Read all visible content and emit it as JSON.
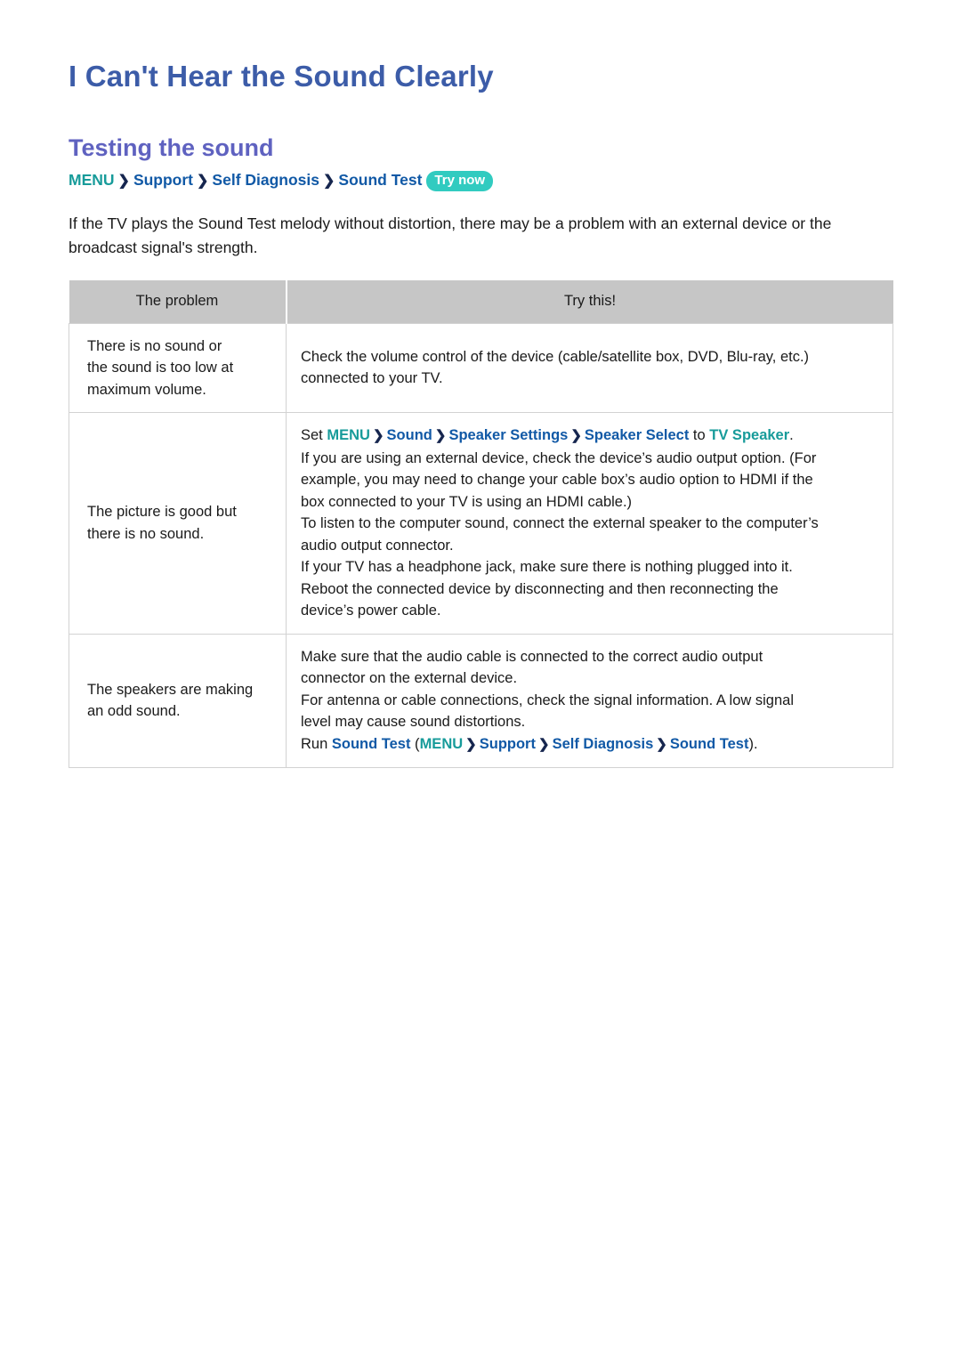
{
  "page": {
    "title": "I Can't Hear the Sound Clearly",
    "section_heading": "Testing the sound",
    "intro": "If the TV plays the Sound Test melody without distortion, there may be a problem with an external device or the broadcast signal's strength."
  },
  "breadcrumb": {
    "menu": "MENU",
    "sep": "❯",
    "support": "Support",
    "self_diagnosis": "Self Diagnosis",
    "sound_test": "Sound Test",
    "try_now": "Try now"
  },
  "table": {
    "headers": {
      "problem": "The problem",
      "try_this": "Try this!"
    },
    "rows": [
      {
        "problem_lines": [
          "There is no sound or",
          "the sound is too low at",
          "maximum volume."
        ],
        "try_lines": [
          "Check the volume control of the device (cable/satellite box, DVD, Blu-ray, etc.)",
          "connected to your TV."
        ]
      },
      {
        "problem_lines": [
          "The picture is good but",
          "there is no sound."
        ],
        "try_lines": [
          "If you are using an external device, check the device’s audio output option. (For",
          "example, you may need to change your cable box’s audio option to HDMI if the",
          "box connected to your TV is using an HDMI cable.)",
          "To listen to the computer sound, connect the external speaker to the computer’s",
          "audio output connector.",
          "If your TV has a headphone jack, make sure there is nothing plugged into it.",
          "Reboot the connected device by disconnecting and then reconnecting the",
          "device’s power cable."
        ],
        "menu_line": {
          "set": "Set ",
          "menu": "MENU",
          "sound": "Sound",
          "speaker_settings": "Speaker Settings",
          "speaker_select": "Speaker Select",
          "to": " to ",
          "tv_speaker": "TV Speaker",
          "period": "."
        }
      },
      {
        "problem_lines": [
          "The speakers are making",
          "an odd sound."
        ],
        "try_lines": [
          "Make sure that the audio cable is connected to the correct audio output",
          "connector on the external device.",
          "For antenna or cable connections, check the signal information. A low signal",
          "level may cause sound distortions."
        ],
        "run_line": {
          "run": "Run ",
          "sound_test_1": "Sound Test",
          "open_paren": " (",
          "menu": "MENU",
          "support": "Support",
          "self_diagnosis": "Self Diagnosis",
          "sound_test_2": "Sound Test",
          "close_paren": ")."
        }
      }
    ]
  }
}
